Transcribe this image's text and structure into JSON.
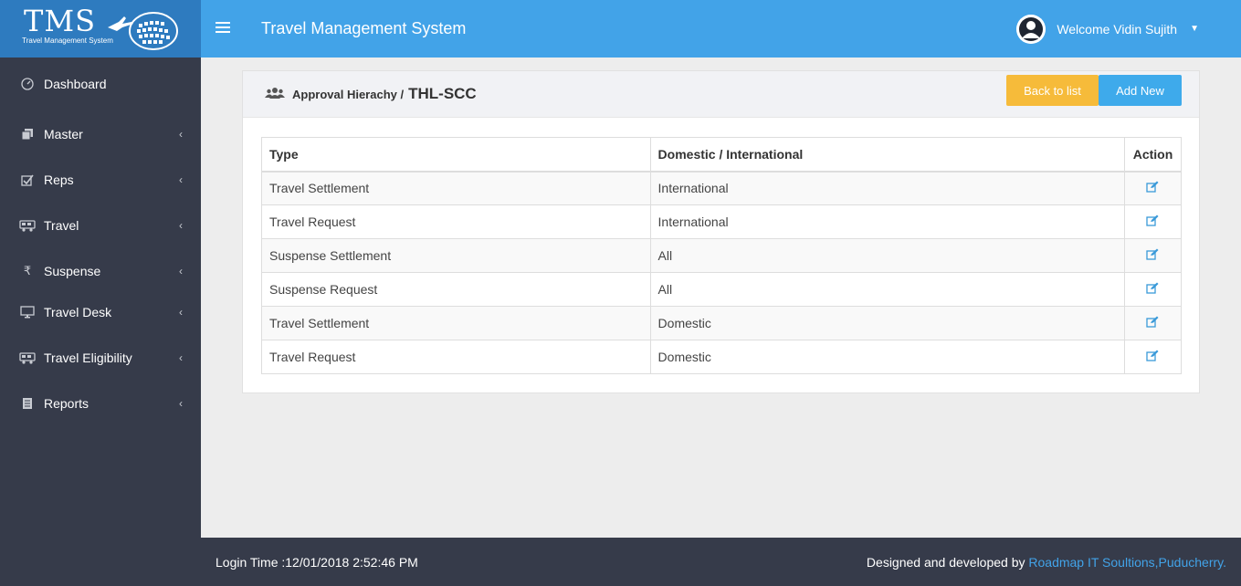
{
  "logo": {
    "text": "TMS",
    "subtitle": "Travel Management System"
  },
  "header": {
    "title": "Travel Management System",
    "welcome": "Welcome Vidin Sujith"
  },
  "sidebar": {
    "items": [
      {
        "label": "Dashboard",
        "icon": "dashboard-icon",
        "has_submenu": false
      },
      {
        "label": "Master",
        "icon": "copy-icon",
        "has_submenu": true
      },
      {
        "label": "Reps",
        "icon": "check-square-icon",
        "has_submenu": true
      },
      {
        "label": "Travel",
        "icon": "bus-icon",
        "has_submenu": true
      },
      {
        "label": "Suspense",
        "icon": "rupee-icon",
        "has_submenu": true
      },
      {
        "label": "Travel Desk",
        "icon": "monitor-icon",
        "has_submenu": true
      },
      {
        "label": "Travel Eligibility",
        "icon": "bus-icon",
        "has_submenu": true
      },
      {
        "label": "Reports",
        "icon": "document-icon",
        "has_submenu": true
      }
    ]
  },
  "panel": {
    "title": "Approval Hierachy /",
    "subtitle": "THL-SCC",
    "back_label": "Back to list",
    "add_label": "Add New"
  },
  "table": {
    "headers": {
      "type": "Type",
      "scope": "Domestic / International",
      "action": "Action"
    },
    "rows": [
      {
        "type": "Travel Settlement",
        "scope": "International"
      },
      {
        "type": "Travel Request",
        "scope": "International"
      },
      {
        "type": "Suspense Settlement",
        "scope": "All"
      },
      {
        "type": "Suspense Request",
        "scope": "All"
      },
      {
        "type": "Travel Settlement",
        "scope": "Domestic"
      },
      {
        "type": "Travel Request",
        "scope": "Domestic"
      }
    ]
  },
  "footer": {
    "login_time": "Login Time :12/01/2018 2:52:46 PM",
    "designed_by": "Designed and developed by",
    "company": "Roadmap IT Soultions,Puducherry."
  },
  "colors": {
    "sidebar_bg": "#363b4a",
    "header_bg": "#42a3e8",
    "logo_bg": "#2e7bbf",
    "back_button": "#f6bb3a",
    "add_button": "#3eaaeb",
    "edit_icon": "#3a9ad9"
  }
}
